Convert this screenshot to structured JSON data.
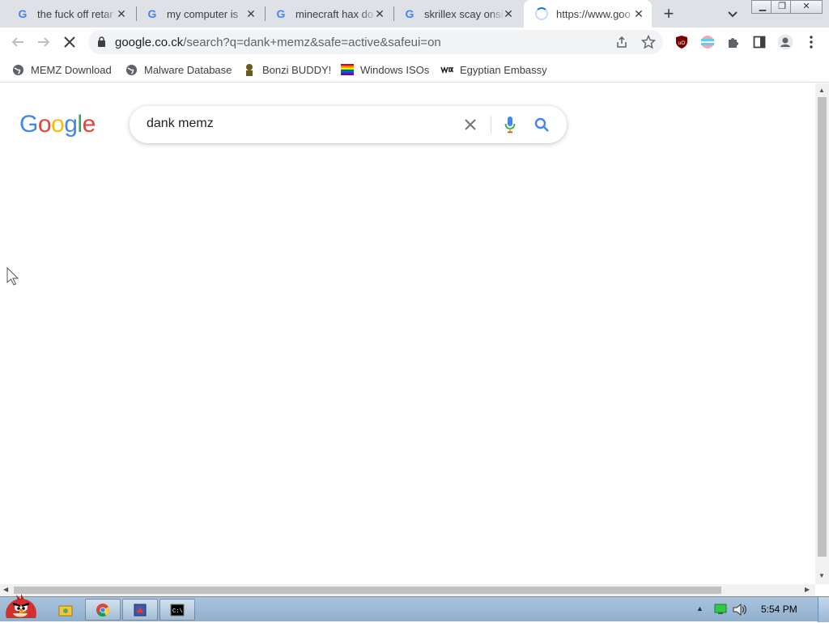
{
  "tabs": [
    {
      "title": "the fuck off retar",
      "favicon": "google-g"
    },
    {
      "title": "my computer is",
      "favicon": "google-g"
    },
    {
      "title": "minecraft hax do",
      "favicon": "google-g"
    },
    {
      "title": "skrillex scay onsi",
      "favicon": "google-g"
    },
    {
      "title": "https://www.goo",
      "favicon": "loading-spinner",
      "active": true
    }
  ],
  "new_tab_label": "+",
  "address_bar": {
    "host": "google.co.ck",
    "path": "/search?q=dank+memz&safe=active&safeui=on"
  },
  "bookmarks": [
    {
      "label": "MEMZ Download",
      "icon": "globe-icon"
    },
    {
      "label": "Malware Database",
      "icon": "globe-icon"
    },
    {
      "label": "Bonzi BUDDY!",
      "icon": "bonzi-icon"
    },
    {
      "label": "Windows ISOs",
      "icon": "rainbow-flag-icon"
    },
    {
      "label": "Egyptian Embassy",
      "icon": "wix-icon"
    }
  ],
  "page": {
    "logo_text": "Google",
    "search_value": "dank memz"
  },
  "taskbar": {
    "clock": "5:54 PM"
  },
  "colors": {
    "google_blue": "#4285F4",
    "google_red": "#EA4335",
    "google_yellow": "#FBBC05",
    "google_green": "#34A853"
  }
}
